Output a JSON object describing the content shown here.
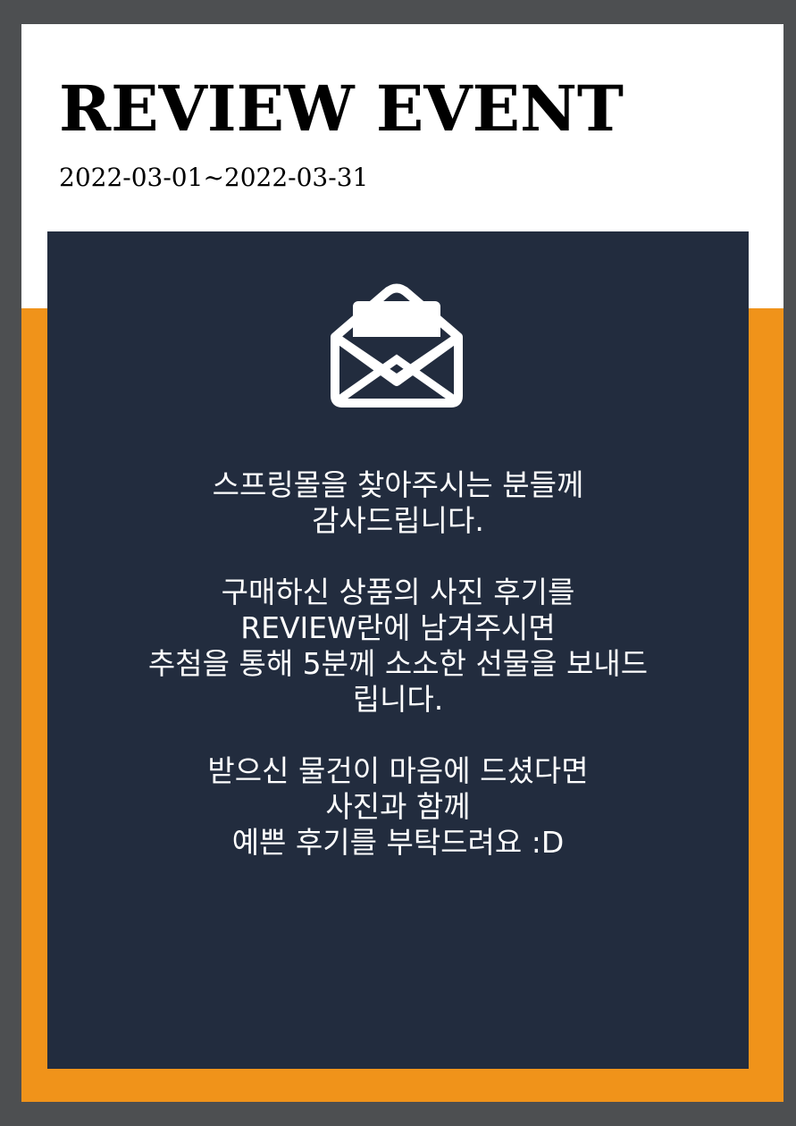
{
  "event": {
    "title": "REVIEW EVENT",
    "period": "2022-03-01~2022-03-31"
  },
  "icon": "open-envelope-icon",
  "message": {
    "paragraph1": {
      "line1": "스프링몰을 찾아주시는 분들께",
      "line2": "감사드립니다."
    },
    "paragraph2": {
      "line1": "구매하신 상품의 사진 후기를",
      "line2": "REVIEW란에 남겨주시면",
      "line3": "추첨을 통해 5분께 소소한 선물을 보내드",
      "line4": "립니다."
    },
    "paragraph3": {
      "line1": "받으신 물건이 마음에 드셨다면",
      "line2": "사진과 함께",
      "line3": "예쁜 후기를 부탁드려요 :D"
    }
  },
  "colors": {
    "frame": "#4d4f51",
    "card": "#ffffff",
    "accent": "#f0931a",
    "panel": "#222c3e",
    "text_on_panel": "#ffffff"
  }
}
